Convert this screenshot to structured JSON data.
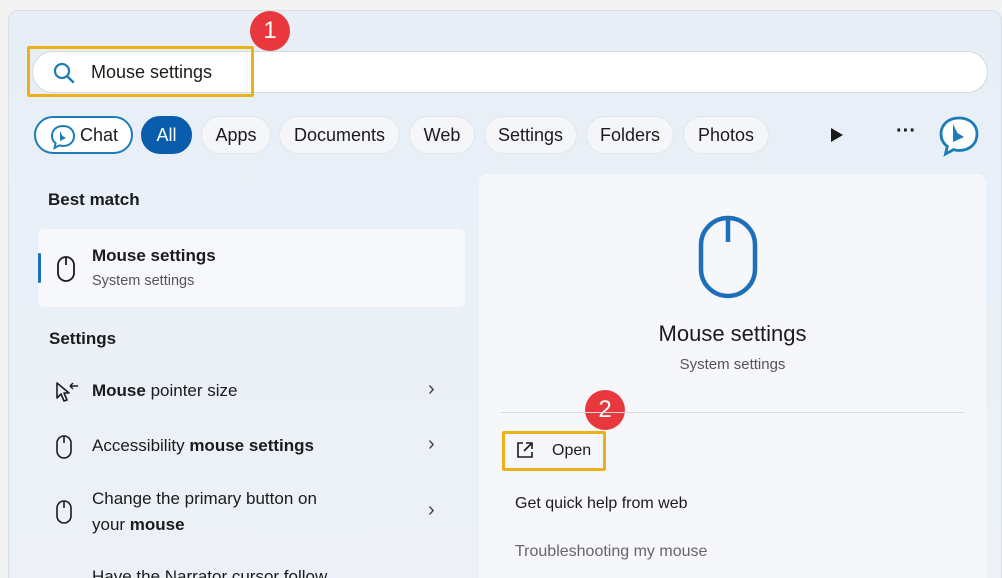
{
  "search": {
    "value": "Mouse settings",
    "step_badge": "1"
  },
  "filters": {
    "chat": "Chat",
    "items": [
      "All",
      "Apps",
      "Documents",
      "Web",
      "Settings",
      "Folders",
      "Photos"
    ],
    "more": "···"
  },
  "best_match": {
    "heading": "Best match",
    "title": "Mouse settings",
    "subtitle": "System settings"
  },
  "settings": {
    "heading": "Settings",
    "items": [
      {
        "pre": "",
        "bold": "Mouse",
        "post": " pointer size"
      },
      {
        "pre": "Accessibility ",
        "bold": "mouse settings",
        "post": ""
      },
      {
        "line1": "Change the primary button on",
        "line2_pre": "your ",
        "line2_bold": "mouse"
      },
      {
        "partial": "Have the Narrator cursor follow"
      }
    ]
  },
  "preview": {
    "title": "Mouse settings",
    "subtitle": "System settings",
    "step_badge": "2",
    "open": "Open",
    "actions": [
      "Get quick help from web",
      "Troubleshooting my mouse"
    ]
  },
  "colors": {
    "accent": "#0a5cad",
    "highlight": "#eab11b",
    "badge": "#e8383d"
  }
}
